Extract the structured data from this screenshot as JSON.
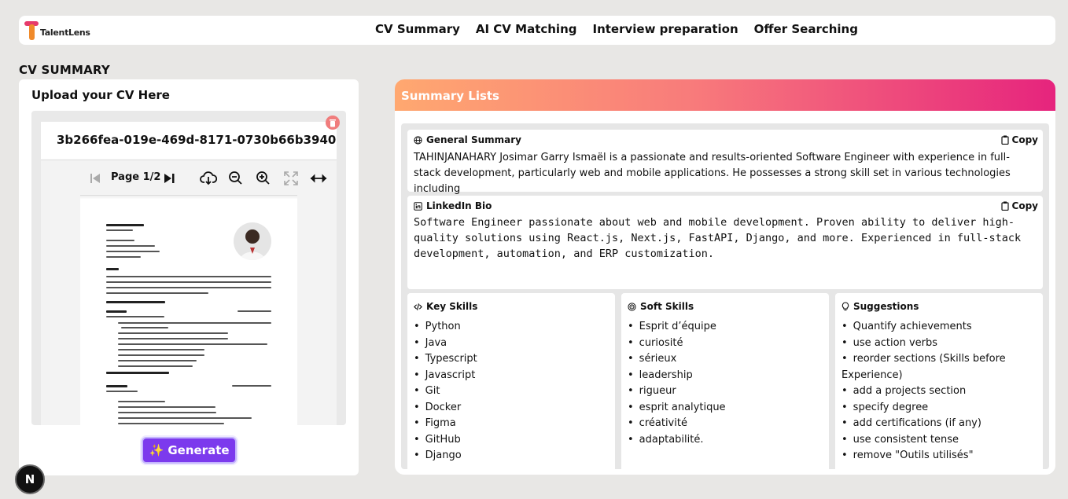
{
  "app": {
    "logo_text": "TalentLens"
  },
  "nav": {
    "links": [
      "CV Summary",
      "AI CV Matching",
      "Interview preparation",
      "Offer Searching"
    ]
  },
  "page": {
    "section_title": "CV SUMMARY"
  },
  "upload": {
    "title": "Upload your CV Here",
    "file_name": "3b266fea-019e-469d-8171-0730b66b3940",
    "page_indicator": "Page 1/2",
    "generate_label": "✨ Generate"
  },
  "summary": {
    "header": "Summary Lists",
    "copy_label": "Copy",
    "general": {
      "title": "General Summary",
      "text": "TAHINJANAHARY Josimar Garry Ismaël is a passionate and results-oriented Software Engineer with experience in full-stack development, particularly web and mobile applications. He possesses a strong skill set in various technologies including"
    },
    "linkedin": {
      "title": "LinkedIn Bio",
      "text": "Software Engineer passionate about web and mobile development. Proven ability to deliver high-quality solutions using React.js, Next.js, FastAPI, Django, and more. Experienced in full-stack development, automation, and ERP customization."
    },
    "key_skills": {
      "title": "Key Skills",
      "items": [
        "Python",
        "Java",
        "Typescript",
        "Javascript",
        "Git",
        "Docker",
        "Figma",
        "GitHub",
        "Django"
      ]
    },
    "soft_skills": {
      "title": "Soft Skills",
      "items": [
        "Esprit d’équipe",
        "curiosité",
        "sérieux",
        "leadership",
        "rigueur",
        "esprit analytique",
        "créativité",
        "adaptabilité."
      ]
    },
    "suggestions": {
      "title": "Suggestions",
      "items": [
        "Quantify achievements",
        "use action verbs",
        "reorder sections (Skills before Experience)",
        "add a projects section",
        "specify degree",
        "add certifications (if any)",
        "use consistent tense",
        "remove \"Outils utilisés\""
      ]
    }
  },
  "badge": {
    "label": "N"
  },
  "colors": {
    "generate": "#7c3aed",
    "header_gradient": [
      "#ffa870",
      "#f87b7b",
      "#e6247d"
    ],
    "delete": "#f07c7c"
  }
}
